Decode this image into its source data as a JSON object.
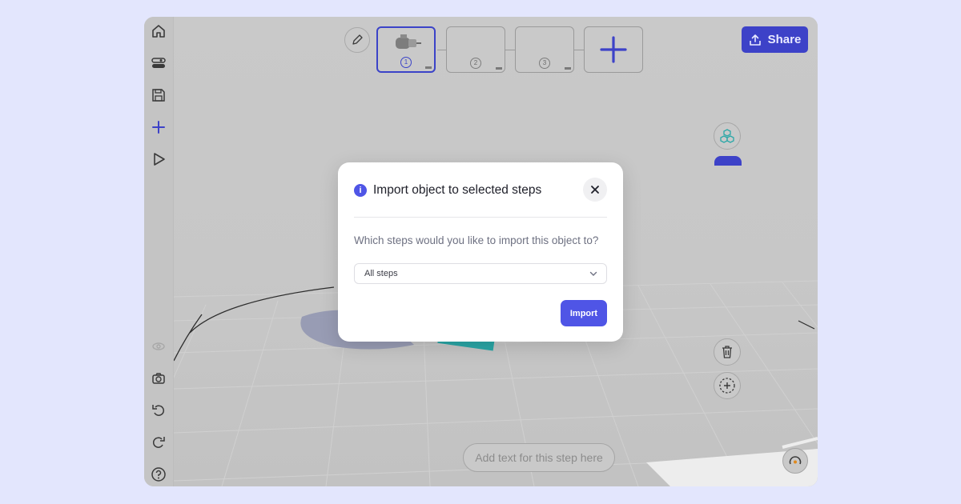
{
  "toolbar": {
    "share_label": "Share",
    "steps": [
      {
        "number": "1",
        "active": true
      },
      {
        "number": "2",
        "active": false
      },
      {
        "number": "3",
        "active": false
      }
    ]
  },
  "sidebar": {
    "icons": [
      "home-icon",
      "toggle-icon",
      "save-icon",
      "plus-icon",
      "play-icon",
      "view-icon",
      "camera-icon",
      "undo-icon",
      "redo-icon",
      "help-icon"
    ]
  },
  "bottom_bar": {
    "text_placeholder": "Add text for this step here"
  },
  "modal": {
    "title": "Import object to selected steps",
    "question": "Which steps would you like to import this object to?",
    "select_value": "All steps",
    "import_label": "Import"
  },
  "colors": {
    "accent": "#4f55e6",
    "share_bg": "#3d42c8",
    "backdrop": "#e3e6fd"
  }
}
